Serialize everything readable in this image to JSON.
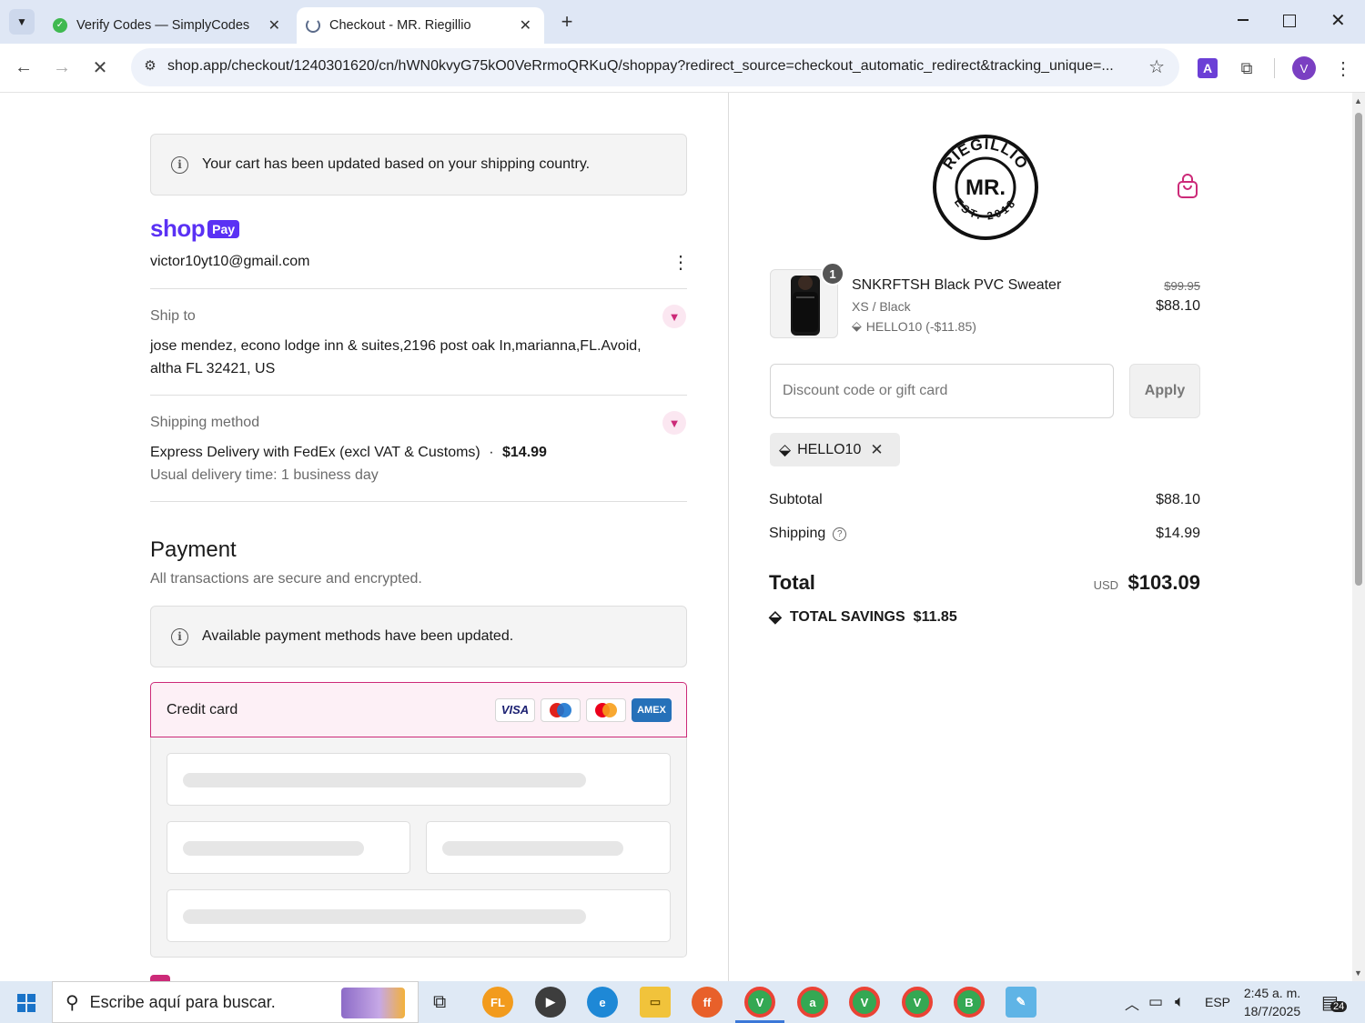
{
  "browser": {
    "tabs": [
      {
        "title": "Verify Codes — SimplyCodes",
        "active": false
      },
      {
        "title": "Checkout - MR. Riegillio",
        "active": true
      }
    ],
    "url": "shop.app/checkout/1240301620/cn/hWN0kvyG75kO0VeRrmoQRKuQ/shoppay?redirect_source=checkout_automatic_redirect&tracking_unique=...",
    "profile_initial": "V",
    "ext_initial": "A"
  },
  "checkout": {
    "cart_notice": "Your cart has been updated based on your shipping country.",
    "shop_pay": {
      "word": "shop",
      "badge": "Pay"
    },
    "email": "victor10yt10@gmail.com",
    "ship_to": {
      "label": "Ship to",
      "line1": "jose mendez, econo lodge inn & suites,2196 post oak In,marianna,FL.Avoid,",
      "line2": "altha FL 32421, US"
    },
    "shipping_method": {
      "label": "Shipping method",
      "name": "Express Delivery with FedEx (excl VAT & Customs)",
      "separator": "·",
      "price": "$14.99",
      "delivery_time": "Usual delivery time: 1 business day"
    },
    "payment": {
      "heading": "Payment",
      "subtext": "All transactions are secure and encrypted.",
      "notice": "Available payment methods have been updated.",
      "method_label": "Credit card",
      "brands": [
        "VISA",
        "Maestro",
        "Mastercard",
        "AMEX"
      ]
    }
  },
  "summary": {
    "logo": {
      "top_text": "RIEGILLIO",
      "center": "MR.",
      "bottom_text": "EST. 2018"
    },
    "item": {
      "quantity": "1",
      "name": "SNKRFTSH Black PVC Sweater",
      "variant": "XS / Black",
      "discount": "HELLO10 (-$11.85)",
      "original_price": "$99.95",
      "price": "$88.10"
    },
    "discount_input": {
      "placeholder": "Discount code or gift card",
      "apply_label": "Apply"
    },
    "applied_code": "HELLO10",
    "subtotal_label": "Subtotal",
    "subtotal": "$88.10",
    "shipping_label": "Shipping",
    "shipping": "$14.99",
    "total_label": "Total",
    "currency": "USD",
    "total": "$103.09",
    "savings_label": "TOTAL SAVINGS",
    "savings": "$11.85"
  },
  "taskbar": {
    "search_placeholder": "Escribe aquí para buscar.",
    "language": "ESP",
    "time": "2:45 a. m.",
    "date": "18/7/2025",
    "notification_count": "24"
  },
  "colors": {
    "accent": "#cc2a78",
    "shop_pay_purple": "#5a31f4",
    "chrome_bg": "#dfe7f5"
  }
}
